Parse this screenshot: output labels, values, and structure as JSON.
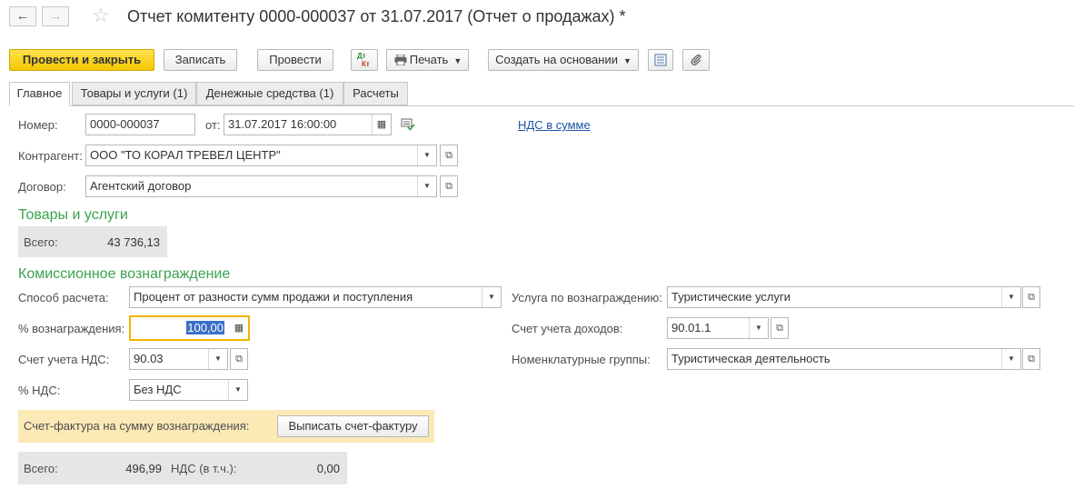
{
  "header": {
    "title": "Отчет комитенту 0000-000037 от 31.07.2017 (Отчет о продажах) *",
    "back_icon": "←",
    "forward_icon": "→",
    "star_icon": "☆"
  },
  "toolbar": {
    "post_close": "Провести и закрыть",
    "save": "Записать",
    "post": "Провести",
    "dtkt_top": "Дт",
    "dtkt_bottom": "Кт",
    "print": "Печать",
    "create_based": "Создать на основании"
  },
  "tabs": [
    {
      "label": "Главное"
    },
    {
      "label": "Товары и услуги (1)"
    },
    {
      "label": "Денежные средства (1)"
    },
    {
      "label": "Расчеты"
    }
  ],
  "form": {
    "number_label": "Номер:",
    "number_value": "0000-000037",
    "date_label": "от:",
    "date_value": "31.07.2017 16:00:00",
    "vat_link": "НДС в сумме",
    "counterparty_label": "Контрагент:",
    "counterparty_value": "ООО \"ТО КОРАЛ ТРЕВЕЛ ЦЕНТР\"",
    "contract_label": "Договор:",
    "contract_value": "Агентский договор"
  },
  "goods": {
    "section_title": "Товары и услуги",
    "total_label": "Всего:",
    "total_value": "43 736,13"
  },
  "commission": {
    "section_title": "Комиссионное вознаграждение",
    "method_label": "Способ расчета:",
    "method_value": "Процент от разности сумм продажи и поступления",
    "percent_label": "% вознаграждения:",
    "percent_value": "100,00",
    "vat_account_label": "Счет учета НДС:",
    "vat_account_value": "90.03",
    "vat_rate_label": "% НДС:",
    "vat_rate_value": "Без НДС",
    "service_label": "Услуга по вознаграждению:",
    "service_value": "Туристические услуги",
    "income_account_label": "Счет учета доходов:",
    "income_account_value": "90.01.1",
    "nomenclature_label": "Номенклатурные группы:",
    "nomenclature_value": "Туристическая деятельность",
    "invoice_label": "Счет-фактура на сумму вознаграждения:",
    "invoice_button": "Выписать счет-фактуру",
    "total_label": "Всего:",
    "total_value": "496,99",
    "vat_incl_label": "НДС (в т.ч.):",
    "vat_incl_value": "0,00"
  },
  "colors": {
    "accent_yellow": "#f5c800",
    "section_green": "#3aa34f",
    "link_blue": "#1c55a6",
    "focus_border": "#f0b400"
  }
}
